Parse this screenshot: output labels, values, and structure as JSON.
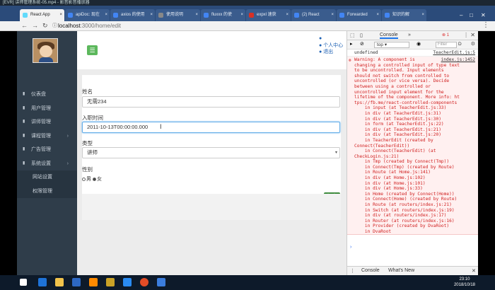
{
  "window_title": "[EVR] 讲师管理系统-05.mp4 - 影音影音播放器",
  "tabs": [
    {
      "label": "React App",
      "color": "#61dafb"
    },
    {
      "label": "apiDoc: 现在",
      "color": "#4285f4"
    },
    {
      "label": "axios 的使用",
      "color": "#4285f4"
    },
    {
      "label": "使用说明",
      "color": "#888888"
    },
    {
      "label": "fluxxx 的使",
      "color": "#4285f4"
    },
    {
      "label": "expxl 速获",
      "color": "#d93025"
    },
    {
      "label": "(2) React",
      "color": "#4285f4"
    },
    {
      "label": "Forwarded",
      "color": "#4285f4"
    },
    {
      "label": "知识的解",
      "color": "#4285f4"
    }
  ],
  "address": {
    "host": "localhost",
    "path": ":3000/home/edit"
  },
  "sidebar": {
    "items": [
      {
        "label": "仪表盘",
        "icon": "dashboard-icon",
        "arrow": ""
      },
      {
        "label": "用户管理",
        "icon": "users-icon",
        "arrow": ""
      },
      {
        "label": "讲师管理",
        "icon": "teacher-icon",
        "arrow": ""
      },
      {
        "label": "课程管理",
        "icon": "course-icon",
        "arrow": "›"
      },
      {
        "label": "广告管理",
        "icon": "ad-icon",
        "arrow": ""
      },
      {
        "label": "系统设置",
        "icon": "settings-icon",
        "arrow": "›"
      },
      {
        "label": "网站设置",
        "icon": "",
        "arrow": ""
      },
      {
        "label": "权限管理",
        "icon": "",
        "arrow": ""
      }
    ]
  },
  "topbar": {
    "links": [
      "",
      "个人中心",
      "退出"
    ]
  },
  "form": {
    "name_label": "姓名",
    "name_value": "无需234",
    "date_label": "入职时间",
    "date_value": "2011-10-13T00:00:00.000",
    "type_label": "类型",
    "type_value": "讲师",
    "gender_label": "性别",
    "gender_options": [
      "男",
      "女"
    ],
    "gender_checked": "男",
    "save_label": "保 存"
  },
  "devtools": {
    "tab_label": "Console",
    "more_label": "»",
    "error_count": "1",
    "context": "top",
    "filter_placeholder": "Filter",
    "level_label": "D",
    "line1": "undefined",
    "line1_src": "TeacherEdit.js:5",
    "error_src": "index.js:1452",
    "error_text": "Warning: A component is \nchanging a controlled input of type text\nto be uncontrolled. Input elements\nshould not switch from controlled to\nuncontrolled (or vice versa). Decide\nbetween using a controlled or\nuncontrolled input element for the\nlifetime of the component. More info: ht\ntps://fb.me/react-controlled-components\n    in input (at TeacherEdit.js:33)\n    in div (at TeacherEdit.js:31)\n    in div (at TeacherEdit.js:30)\n    in form (at TeacherEdit.js:22)\n    in div (at TeacherEdit.js:21)\n    in div (at TeacherEdit.js:20)\n    in TeacherEdit (created by\nConnect(TeacherEdit))\n    in Connect(TeacherEdit) (at\nCheckLogin.js:21)\n    in Tmp (created by Connect(Tmp))\n    in Connect(Tmp) (created by Route)\n    in Route (at Home.js:141)\n    in div (at Home.js:102)\n    in div (at Home.js:101)\n    in div (at Home.js:33)\n    in Home (created by Connect(Home))\n    in Connect(Home) (created by Route)\n    in Route (at routers/index.js:21)\n    in Switch (at routers/index.js:19)\n    in div (at routers/index.js:17)\n    in Router (at routers/index.js:16)\n    in Provider (created by DvaRoot)\n    in DvaRoot",
    "prompt": "›",
    "drawer_tabs": [
      "Console",
      "What's New"
    ]
  },
  "taskbar": {
    "time": "23:10",
    "date": "2018/10/18"
  },
  "colors": {
    "sidebar_bg": "#2f3d4a",
    "accent_green": "#5cb85c",
    "error_red": "#d02020",
    "link_blue": "#1b5fb3"
  }
}
